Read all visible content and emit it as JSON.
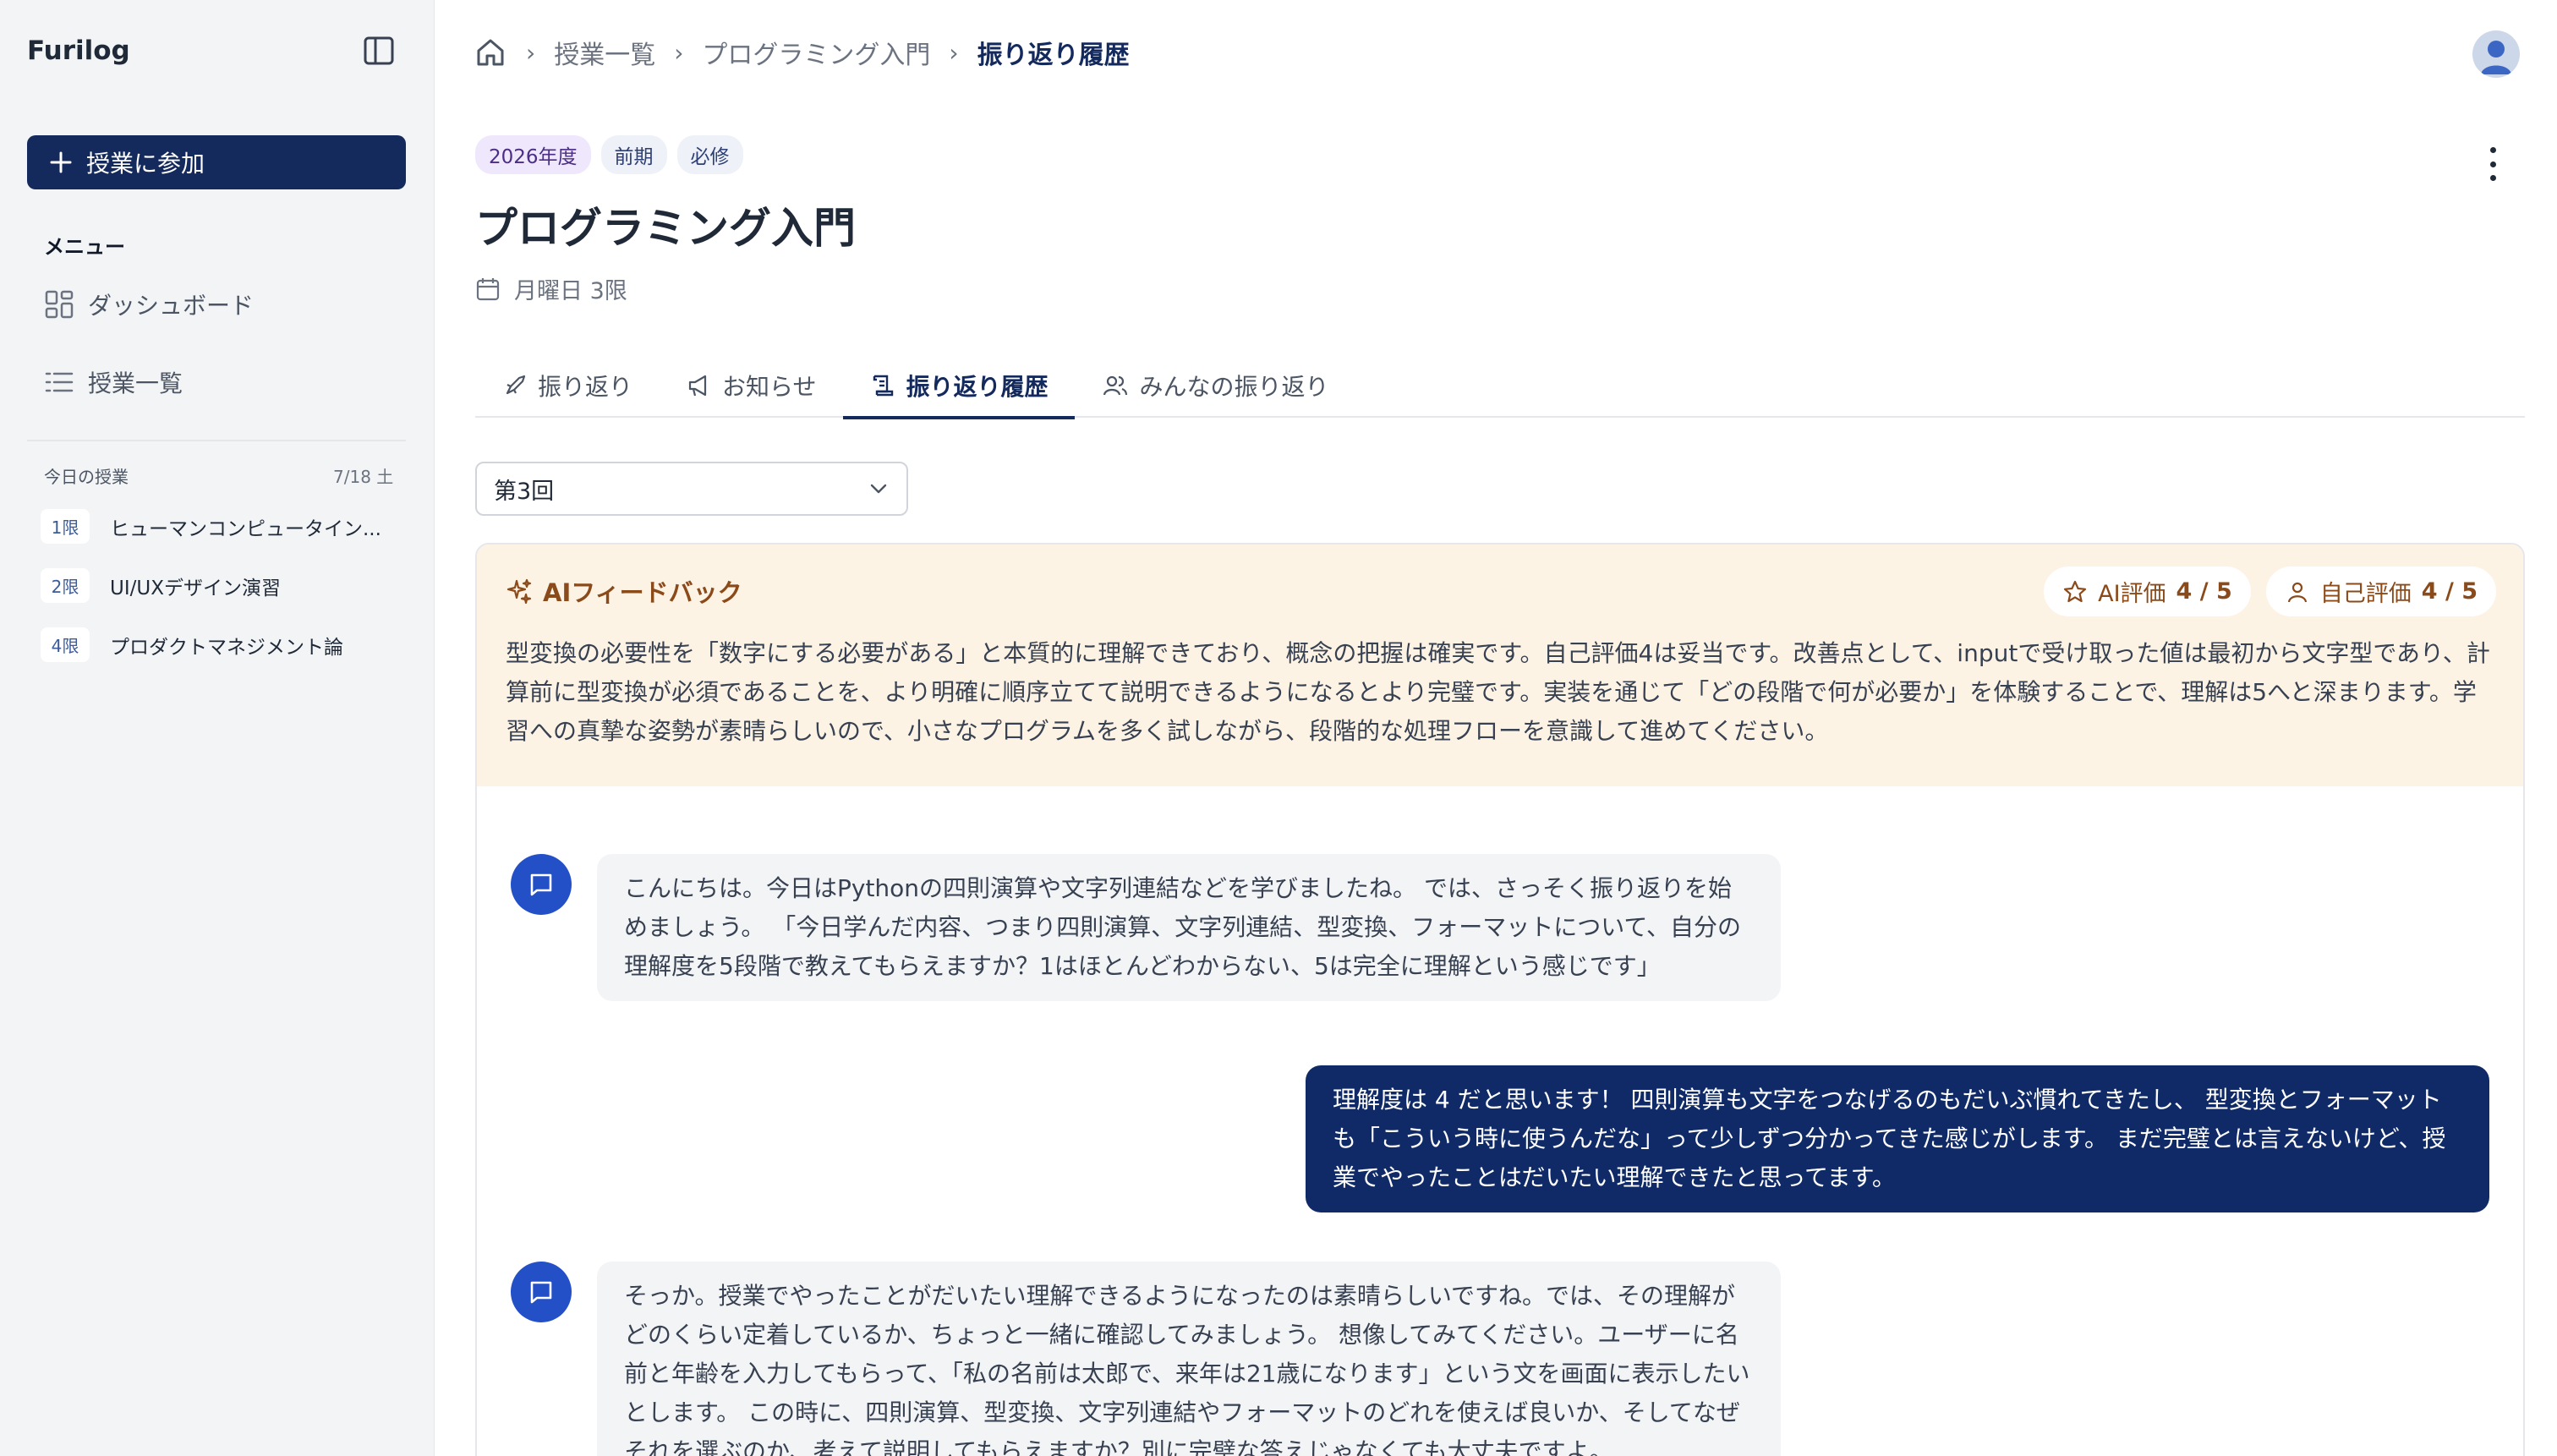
{
  "sidebar": {
    "brand": "Furilog",
    "join_button": "授業に参加",
    "menu_title": "メニュー",
    "nav": [
      {
        "label": "ダッシュボード",
        "icon": "dashboard-icon"
      },
      {
        "label": "授業一覧",
        "icon": "list-icon"
      }
    ],
    "today_title": "今日の授業",
    "today_date": "7/18 土",
    "today_classes": [
      {
        "period": "1限",
        "name": "ヒューマンコンピュータイン..."
      },
      {
        "period": "2限",
        "name": "UI/UXデザイン演習"
      },
      {
        "period": "4限",
        "name": "プロダクトマネジメント論"
      }
    ]
  },
  "breadcrumb": {
    "items": [
      "授業一覧",
      "プログラミング入門"
    ],
    "current": "振り返り履歴"
  },
  "course": {
    "badges": [
      "2026年度",
      "前期",
      "必修"
    ],
    "title": "プログラミング入門",
    "schedule": "月曜日 3限"
  },
  "tabs": [
    {
      "label": "振り返り",
      "icon": "rocket-icon"
    },
    {
      "label": "お知らせ",
      "icon": "megaphone-icon"
    },
    {
      "label": "振り返り履歴",
      "icon": "history-icon",
      "active": true
    },
    {
      "label": "みんなの振り返り",
      "icon": "users-icon"
    }
  ],
  "session_select": {
    "value": "第3回"
  },
  "feedback": {
    "title": "AIフィードバック",
    "ai_rating": {
      "label": "AI評価",
      "value": "4 / 5"
    },
    "self_rating": {
      "label": "自己評価",
      "value": "4 / 5"
    },
    "text": "型変換の必要性を「数字にする必要がある」と本質的に理解できており、概念の把握は確実です。自己評価4は妥当です。改善点として、inputで受け取った値は最初から文字型であり、計算前に型変換が必須であることを、より明確に順序立てて説明できるようになるとより完璧です。実装を通じて「どの段階で何が必要か」を体験することで、理解は5へと深まります。学習への真摯な姿勢が素晴らしいので、小さなプログラムを多く試しながら、段階的な処理フローを意識して進めてください。"
  },
  "messages": [
    {
      "role": "bot",
      "text": "こんにちは。今日はPythonの四則演算や文字列連結などを学びましたね。 では、さっそく振り返りを始めましょう。 「今日学んだ内容、つまり四則演算、文字列連結、型変換、フォーマットについて、自分の理解度を5段階で教えてもらえますか？1はほとんどわからない、5は完全に理解という感じです」"
    },
    {
      "role": "user",
      "text": "理解度は 4 だと思います！ 四則演算も文字をつなげるのもだいぶ慣れてきたし、 型変換とフォーマットも「こういう時に使うんだな」って少しずつ分かってきた感じがします。 まだ完璧とは言えないけど、授業でやったことはだいたい理解できたと思ってます。"
    },
    {
      "role": "bot",
      "text": "そっか。授業でやったことがだいたい理解できるようになったのは素晴らしいですね。では、その理解がどのくらい定着しているか、ちょっと一緒に確認してみましょう。 想像してみてください。ユーザーに名前と年齢を入力してもらって、「私の名前は太郎で、来年は21歳になります」という文を画面に表示したいとします。 この時に、四則演算、型変換、文字列連結やフォーマットのどれを使えば良いか、そしてなぜそれを選ぶのか、考えて説明してもらえますか？別に完璧な答えじゃなくても大丈夫ですよ。"
    }
  ]
}
